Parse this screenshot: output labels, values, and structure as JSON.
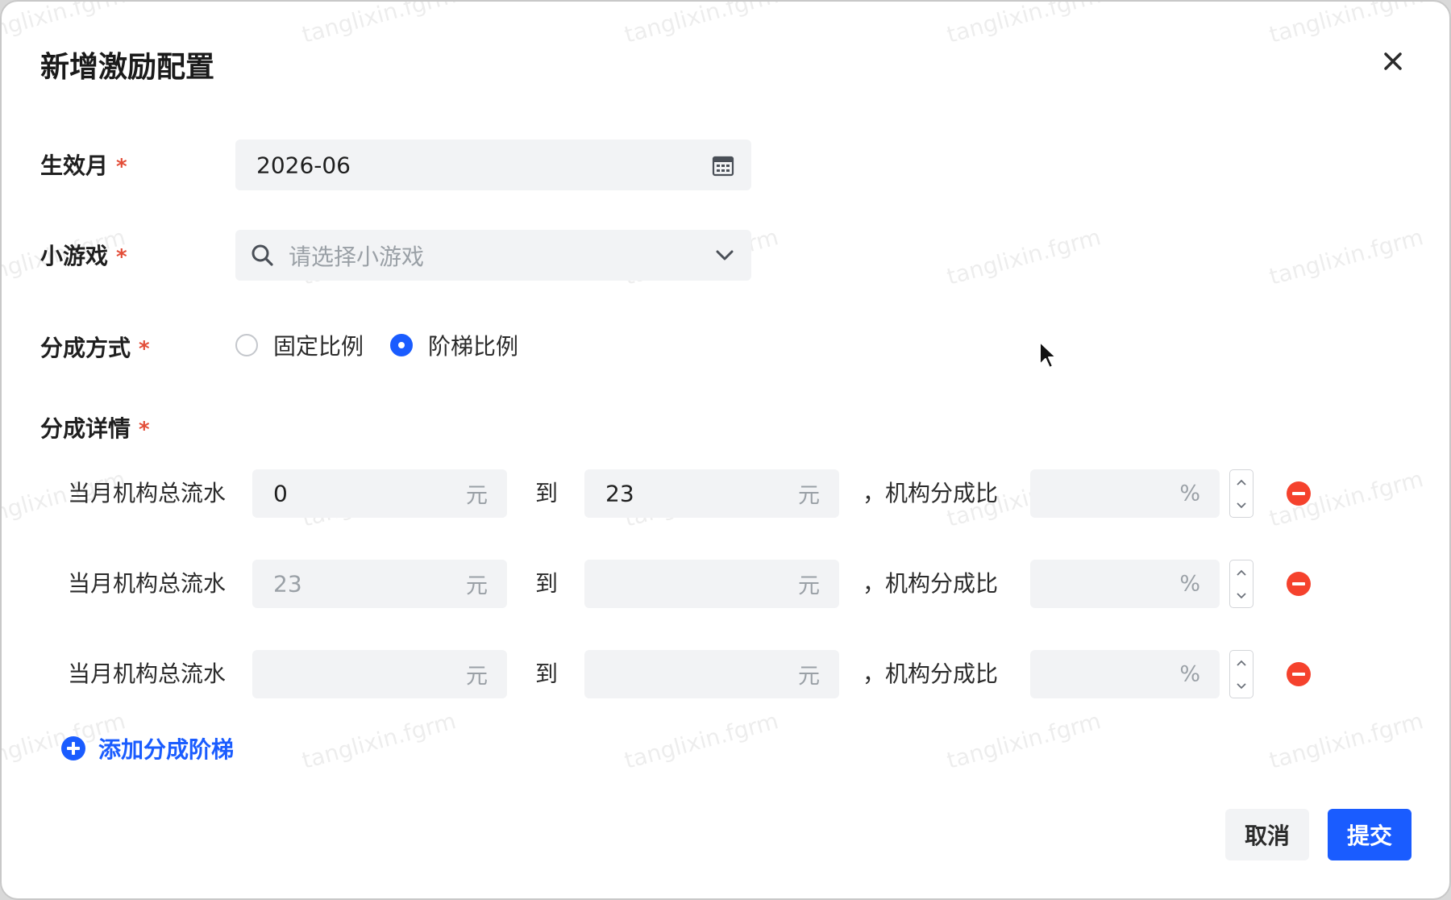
{
  "dialog": {
    "title": "新增激励配置"
  },
  "form": {
    "effective_month": {
      "label": "生效月",
      "required_mark": "*",
      "value": "2026-06"
    },
    "mini_game": {
      "label": "小游戏",
      "required_mark": "*",
      "placeholder": "请选择小游戏"
    },
    "split_method": {
      "label": "分成方式",
      "required_mark": "*",
      "options": [
        {
          "label": "固定比例",
          "selected": false
        },
        {
          "label": "阶梯比例",
          "selected": true
        }
      ]
    },
    "split_details": {
      "label": "分成详情",
      "required_mark": "*",
      "tier_prefix": "当月机构总流水",
      "to_text": "到",
      "ratio_text": "，机构分成比",
      "yuan_unit": "元",
      "percent_unit": "%",
      "tiers": [
        {
          "from": "0",
          "from_placeholder": "",
          "to": "23",
          "ratio": ""
        },
        {
          "from": "",
          "from_placeholder": "23",
          "to": "",
          "ratio": ""
        },
        {
          "from": "",
          "from_placeholder": "",
          "to": "",
          "ratio": ""
        }
      ],
      "add_tier_label": "添加分成阶梯"
    }
  },
  "footer": {
    "cancel_label": "取消",
    "submit_label": "提交"
  },
  "watermark_text": "tanglixin.fgrm",
  "colors": {
    "primary": "#1a5cff",
    "danger": "#f5422d",
    "required": "#e34d38",
    "input_bg": "#f2f3f5"
  }
}
